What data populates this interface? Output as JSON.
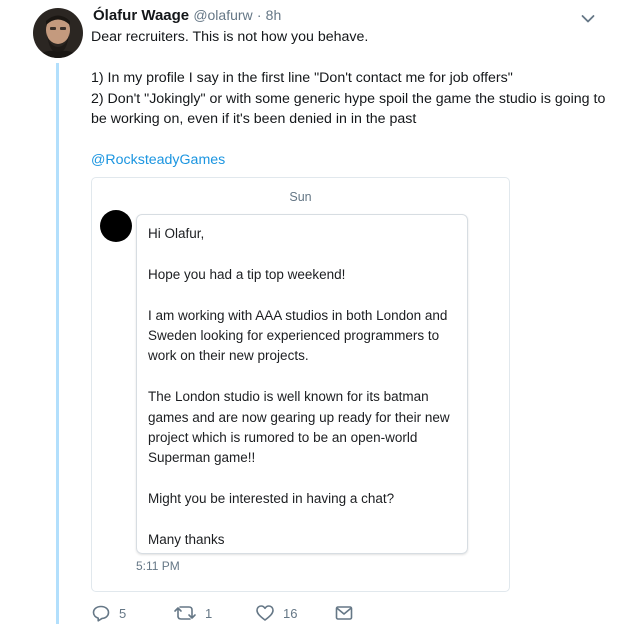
{
  "tweet": {
    "author_name": "Ólafur Waage",
    "author_handle": "@olafurw",
    "separator": "·",
    "time": "8h",
    "lines": [
      "Dear recruiters. This is not how you behave.",
      "",
      "1) In my profile I say in the first line \"Don't contact me for job offers\"",
      "2) Don't \"Jokingly\" or with some generic hype spoil the game the studio is going to be working on, even if it's been denied in in the past",
      ""
    ],
    "mention": "@RocksteadyGames"
  },
  "dm_card": {
    "day": "Sun",
    "message_paragraphs": [
      "Hi Olafur,",
      "Hope you had a tip top weekend!",
      "I am working with AAA studios in both London and Sweden looking for experienced programmers to work on their new projects.",
      "The London studio is well known for its batman games and are now gearing up ready for their new project which is rumored to be an open-world Superman game!!",
      "Might you be interested in having a chat?",
      "Many thanks"
    ],
    "time": "5:11 PM"
  },
  "actions": {
    "reply_count": "5",
    "retweet_count": "1",
    "like_count": "16",
    "icons": [
      "reply-icon",
      "retweet-icon",
      "like-icon",
      "direct-message-icon"
    ]
  },
  "colors": {
    "link": "#1b95e0",
    "thread_line": "#b2dffc",
    "secondary_text": "#657786"
  }
}
